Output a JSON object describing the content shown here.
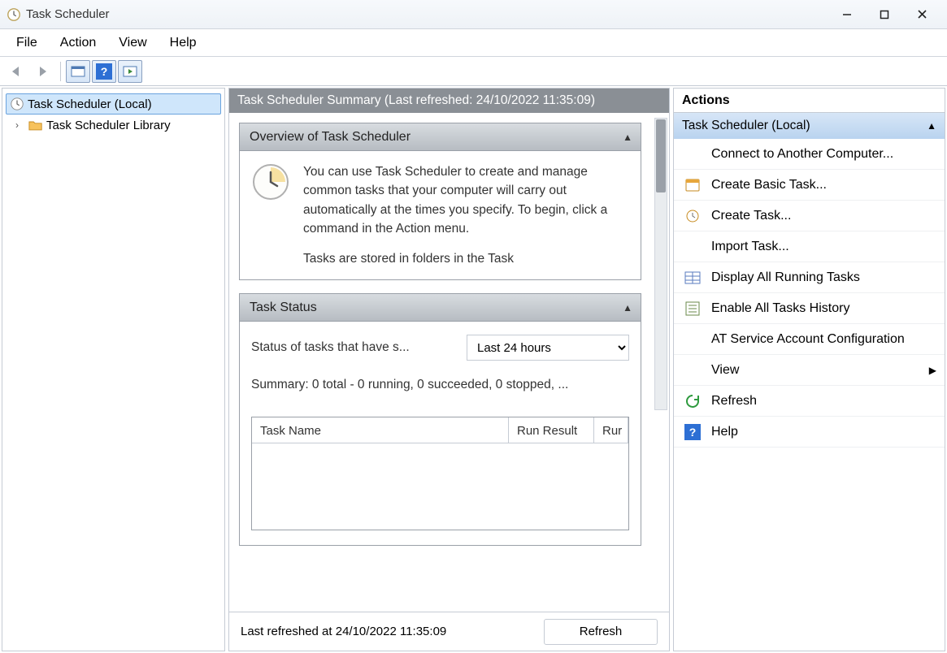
{
  "window": {
    "title": "Task Scheduler"
  },
  "menu": {
    "file": "File",
    "action": "Action",
    "view": "View",
    "help": "Help"
  },
  "tree": {
    "root": "Task Scheduler (Local)",
    "child": "Task Scheduler Library"
  },
  "summary": {
    "header": "Task Scheduler Summary (Last refreshed: 24/10/2022 11:35:09)",
    "overview_title": "Overview of Task Scheduler",
    "overview_p1": "You can use Task Scheduler to create and manage common tasks that your computer will carry out automatically at the times you specify. To begin, click a command in the Action menu.",
    "overview_p2": "Tasks are stored in folders in the Task",
    "status_title": "Task Status",
    "status_label": "Status of tasks that have s...",
    "status_option": "Last 24 hours",
    "status_summary": "Summary: 0 total - 0 running, 0 succeeded, 0 stopped, ...",
    "th_name": "Task Name",
    "th_result": "Run Result",
    "th_run": "Rur",
    "footer": "Last refreshed at 24/10/2022 11:35:09",
    "refresh_btn": "Refresh"
  },
  "actions": {
    "title": "Actions",
    "section": "Task Scheduler (Local)",
    "items": [
      {
        "label": "Connect to Another Computer...",
        "icon": ""
      },
      {
        "label": "Create Basic Task...",
        "icon": "calendar"
      },
      {
        "label": "Create Task...",
        "icon": "clock-small"
      },
      {
        "label": "Import Task...",
        "icon": ""
      },
      {
        "label": "Display All Running Tasks",
        "icon": "grid"
      },
      {
        "label": "Enable All Tasks History",
        "icon": "list"
      },
      {
        "label": "AT Service Account Configuration",
        "icon": ""
      },
      {
        "label": "View",
        "icon": "",
        "chev": true
      },
      {
        "label": "Refresh",
        "icon": "refresh"
      },
      {
        "label": "Help",
        "icon": "help"
      }
    ]
  }
}
